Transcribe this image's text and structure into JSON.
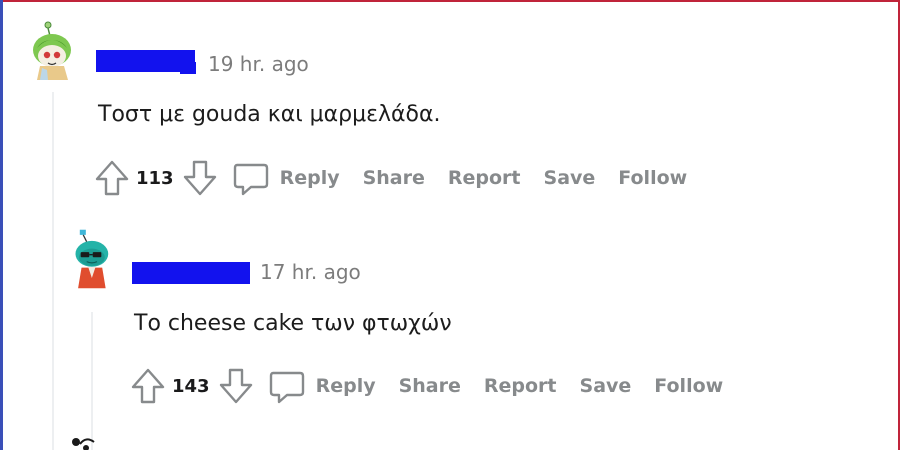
{
  "comments": [
    {
      "timestamp": "19 hr. ago",
      "body": "Τοστ με gouda και μαρμελάδα.",
      "score": "113",
      "actions": {
        "reply": "Reply",
        "share": "Share",
        "report": "Report",
        "save": "Save",
        "follow": "Follow"
      },
      "avatar_icon": "snoo-avatar-green-icon"
    },
    {
      "timestamp": "17 hr. ago",
      "body": "Το cheese cake των φτωχών",
      "score": "143",
      "actions": {
        "reply": "Reply",
        "share": "Share",
        "report": "Report",
        "save": "Save",
        "follow": "Follow"
      },
      "avatar_icon": "snoo-avatar-teal-icon"
    }
  ],
  "colors": {
    "redaction": "#1212ee",
    "meta_gray": "#7c7c7c",
    "action_gray": "#878a8c",
    "thread_line": "#edeff1"
  }
}
